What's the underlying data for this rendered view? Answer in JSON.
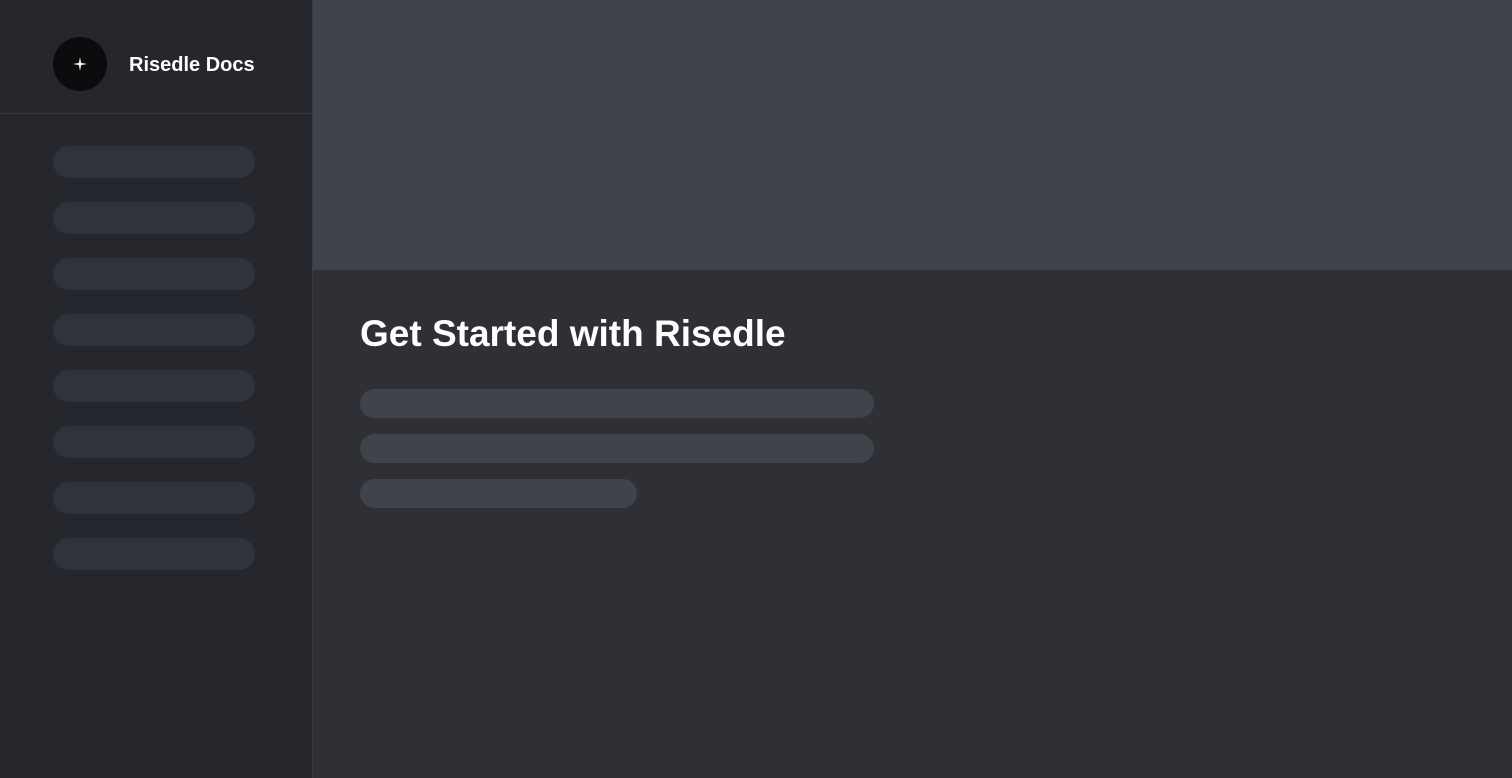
{
  "sidebar": {
    "brand_name": "Risedle Docs",
    "logo_icon": "sparkle-icon",
    "nav_placeholders": 8
  },
  "main": {
    "title": "Get Started with Risedle",
    "text_placeholders": 3
  },
  "colors": {
    "sidebar_bg": "#26272c",
    "main_bg": "#2f3035",
    "hero_bg": "#41434b",
    "skeleton_nav": "#2f333b",
    "skeleton_text": "#41434b",
    "logo_bg": "#0c0c0e",
    "text": "#ffffff"
  }
}
